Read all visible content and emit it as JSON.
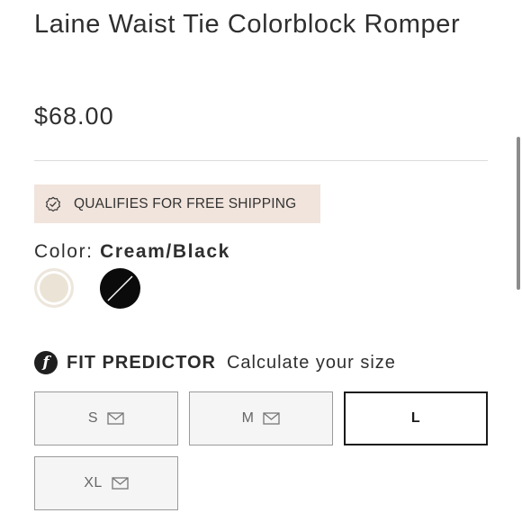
{
  "product": {
    "title": "Laine Waist Tie Colorblock Romper",
    "price": "$68.00"
  },
  "shipping_badge": {
    "icon": "badge-check-icon",
    "text": "QUALIFIES FOR FREE SHIPPING",
    "background": "#f1e4dc"
  },
  "color": {
    "label": "Color:",
    "selected_value": "Cream/Black",
    "swatches": [
      {
        "name": "Cream",
        "color": "#ebe4d6",
        "selected": true
      },
      {
        "name": "Black",
        "color": "#0b0b0b",
        "selected": false,
        "unavailable": true
      }
    ]
  },
  "fit_predictor": {
    "logo_letter": "f",
    "label": "FIT PREDICTOR",
    "link_text": "Calculate your size"
  },
  "sizes": [
    {
      "label": "S",
      "icon": "mail-icon",
      "selected": false
    },
    {
      "label": "M",
      "icon": "mail-icon",
      "selected": false
    },
    {
      "label": "L",
      "selected": true
    },
    {
      "label": "XL",
      "icon": "mail-icon",
      "selected": false
    }
  ]
}
